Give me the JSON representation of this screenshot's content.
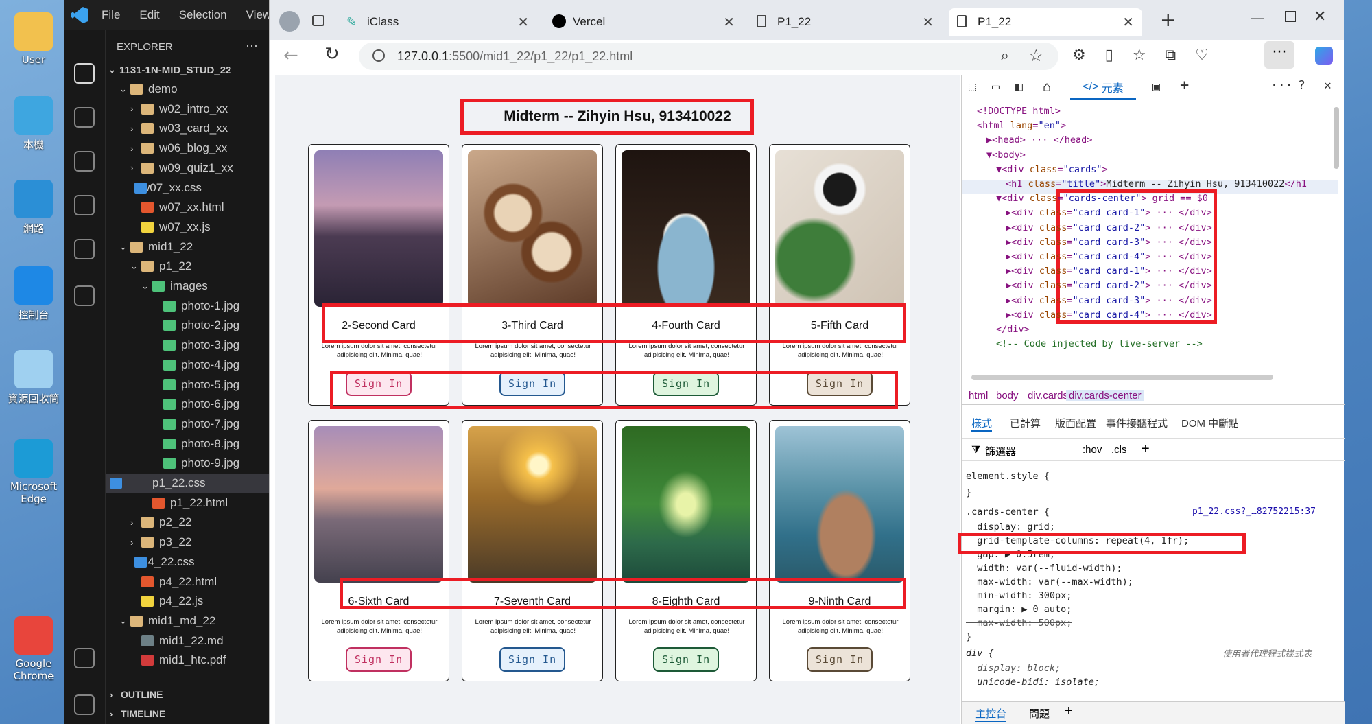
{
  "desktop": {
    "icons": [
      {
        "label": "User",
        "color": "#f2c14e"
      },
      {
        "label": "本機",
        "color": "#3ea6e0"
      },
      {
        "label": "網路",
        "color": "#2b8fd6"
      },
      {
        "label": "控制台",
        "color": "#1e88e5"
      },
      {
        "label": "資源回收筒",
        "color": "#9fd0f0"
      },
      {
        "label": "Microsoft Edge",
        "color": "#1c9bd6"
      },
      {
        "label": "Google Chrome",
        "color": "#e8453c"
      }
    ]
  },
  "vscode": {
    "menu": [
      "File",
      "Edit",
      "Selection",
      "View"
    ],
    "explorer_title": "EXPLORER",
    "explorer_more": "···",
    "root": "1131-1N-MID_STUD_22",
    "tree": [
      {
        "label": "demo",
        "icon": "folder",
        "arrow": "⌄",
        "indent": 1
      },
      {
        "label": "w02_intro_xx",
        "icon": "folder",
        "arrow": "›",
        "indent": 2
      },
      {
        "label": "w03_card_xx",
        "icon": "folder",
        "arrow": "›",
        "indent": 2
      },
      {
        "label": "w06_blog_xx",
        "icon": "folder",
        "arrow": "›",
        "indent": 2
      },
      {
        "label": "w09_quiz1_xx",
        "icon": "folder",
        "arrow": "›",
        "indent": 2
      },
      {
        "label": "w07_xx.css",
        "icon": "css",
        "arrow": "",
        "indent": 2
      },
      {
        "label": "w07_xx.html",
        "icon": "html",
        "arrow": "",
        "indent": 2
      },
      {
        "label": "w07_xx.js",
        "icon": "js",
        "arrow": "",
        "indent": 2
      },
      {
        "label": "mid1_22",
        "icon": "folder",
        "arrow": "⌄",
        "indent": 1
      },
      {
        "label": "p1_22",
        "icon": "folder",
        "arrow": "⌄",
        "indent": 2
      },
      {
        "label": "images",
        "icon": "img",
        "arrow": "⌄",
        "indent": 3
      },
      {
        "label": "photo-1.jpg",
        "icon": "img",
        "arrow": "",
        "indent": 4
      },
      {
        "label": "photo-2.jpg",
        "icon": "img",
        "arrow": "",
        "indent": 4
      },
      {
        "label": "photo-3.jpg",
        "icon": "img",
        "arrow": "",
        "indent": 4
      },
      {
        "label": "photo-4.jpg",
        "icon": "img",
        "arrow": "",
        "indent": 4
      },
      {
        "label": "photo-5.jpg",
        "icon": "img",
        "arrow": "",
        "indent": 4
      },
      {
        "label": "photo-6.jpg",
        "icon": "img",
        "arrow": "",
        "indent": 4
      },
      {
        "label": "photo-7.jpg",
        "icon": "img",
        "arrow": "",
        "indent": 4
      },
      {
        "label": "photo-8.jpg",
        "icon": "img",
        "arrow": "",
        "indent": 4
      },
      {
        "label": "photo-9.jpg",
        "icon": "img",
        "arrow": "",
        "indent": 4
      },
      {
        "label": "p1_22.css",
        "icon": "css",
        "arrow": "",
        "indent": 3,
        "selected": true
      },
      {
        "label": "p1_22.html",
        "icon": "html",
        "arrow": "",
        "indent": 3
      },
      {
        "label": "p2_22",
        "icon": "folder",
        "arrow": "›",
        "indent": 2
      },
      {
        "label": "p3_22",
        "icon": "folder",
        "arrow": "›",
        "indent": 2
      },
      {
        "label": "p4_22.css",
        "icon": "css",
        "arrow": "",
        "indent": 2
      },
      {
        "label": "p4_22.html",
        "icon": "html",
        "arrow": "",
        "indent": 2
      },
      {
        "label": "p4_22.js",
        "icon": "js",
        "arrow": "",
        "indent": 2
      },
      {
        "label": "mid1_md_22",
        "icon": "folder",
        "arrow": "⌄",
        "indent": 1
      },
      {
        "label": "mid1_22.md",
        "icon": "md",
        "arrow": "",
        "indent": 2
      },
      {
        "label": "mid1_htc.pdf",
        "icon": "pdf",
        "arrow": "",
        "indent": 2
      }
    ],
    "outline": "OUTLINE",
    "timeline": "TIMELINE"
  },
  "browser": {
    "tabs": [
      {
        "label": "iClass"
      },
      {
        "label": "Vercel"
      },
      {
        "label": "P1_22"
      },
      {
        "label": "P1_22",
        "active": true
      }
    ],
    "new_tab": "+",
    "url_host": "127.0.0.1",
    "url_rest": ":5500/mid1_22/p1_22/p1_22.html"
  },
  "page": {
    "title": "Midterm -- Zihyin Hsu, 913410022",
    "cards": [
      {
        "title": "2-Second Card",
        "text": "Lorem ipsum dolor sit amet, consectetur adipisicing elit. Minima, quae!",
        "button": "Sign In",
        "style": "b1",
        "photo": "linear-gradient(180deg,#8f7fb5 0%,#c49bb3 35%,#4b3b52 55%,#2a2335 100%)"
      },
      {
        "title": "3-Third Card",
        "text": "Lorem ipsum dolor sit amet, consectetur adipisicing elit. Minima, quae!",
        "button": "Sign In",
        "style": "b2",
        "photo": "radial-gradient(circle at 35% 40%,#e9d3b6 0 14%,#7a4a2a 16% 22%,transparent 24%),radial-gradient(circle at 65% 65%,#ecd8bd 0 14%,#6d3f22 16% 22%,transparent 24%),linear-gradient(160deg,#caa88a,#5d3b28)"
      },
      {
        "title": "4-Fourth Card",
        "text": "Lorem ipsum dolor sit amet, consectetur adipisicing elit. Minima, quae!",
        "button": "Sign In",
        "style": "b3",
        "photo": "radial-gradient(ellipse at 50% 75%,#8ab5cf 0 30%,transparent 32%),radial-gradient(circle at 50% 55%,#f2efe8 0 20%,transparent 22%),linear-gradient(180deg,#1e1410,#3a2a1f)"
      },
      {
        "title": "5-Fifth Card",
        "text": "Lorem ipsum dolor sit amet, consectetur adipisicing elit. Minima, quae!",
        "button": "Sign In",
        "style": "b4",
        "photo": "radial-gradient(circle at 50% 25%,#1a1a1a 0 12%,#f4f4f4 13% 18%,transparent 20%),radial-gradient(circle at 30% 70%,#3e7d3a 0 25%,transparent 30%),linear-gradient(135deg,#e7e0d6,#cfc3b4)"
      },
      {
        "title": "6-Sixth Card",
        "text": "Lorem ipsum dolor sit amet, consectetur adipisicing elit. Minima, quae!",
        "button": "Sign In",
        "style": "b1",
        "photo": "linear-gradient(180deg,#a78db8 0%,#e0a99a 40%,#7a6a78 60%,#44414e 100%)"
      },
      {
        "title": "7-Seventh Card",
        "text": "Lorem ipsum dolor sit amet, consectetur adipisicing elit. Minima, quae!",
        "button": "Sign In",
        "style": "b2",
        "photo": "radial-gradient(circle at 55% 25%,#fff6c8 0 6%,#f5c04a 10%,transparent 30%),linear-gradient(180deg,#d6a24a 0%,#9a6b2a 45%,#4a3a28 100%)"
      },
      {
        "title": "8-Eighth Card",
        "text": "Lorem ipsum dolor sit amet, consectetur adipisicing elit. Minima, quae!",
        "button": "Sign In",
        "style": "b3",
        "photo": "radial-gradient(ellipse at 50% 50%,#e8f3a8 0 10%,transparent 30%),linear-gradient(180deg,#2e6a22 0%,#3f8a3a 50%,#2d6a4a 75%,#1d4a3a 100%)"
      },
      {
        "title": "9-Ninth Card",
        "text": "Lorem ipsum dolor sit amet, consectetur adipisicing elit. Minima, quae!",
        "button": "Sign In",
        "style": "b4",
        "photo": "radial-gradient(ellipse at 55% 70%,#b08060 0 25%,transparent 30%),linear-gradient(180deg,#9ec3d6 0%,#5b93a8 40%,#31708a 70%,#2a5a6a 100%)"
      }
    ]
  },
  "devtools": {
    "tab_elements": "元素",
    "code": [
      {
        "i": 0,
        "html": "&lt;!DOCTYPE html&gt;"
      },
      {
        "i": 0,
        "html": "&lt;html <span class='at'>lang</span>=<span class='av'>\"en\"</span>&gt;"
      },
      {
        "i": 1,
        "html": "▶&lt;head&gt; ··· &lt;/head&gt;"
      },
      {
        "i": 1,
        "html": "▼&lt;body&gt;"
      },
      {
        "i": 2,
        "html": "▼&lt;div <span class='at'>class</span>=<span class='av'>\"cards\"</span>&gt;"
      },
      {
        "i": 3,
        "html": "&lt;h1 <span class='at'>class</span>=<span class='av'>\"title\"</span>&gt;<span class='tx'>Midterm -- Zihyin Hsu, 913410022</span>&lt;/h1"
      },
      {
        "i": 2,
        "html": "▼&lt;div <span class='at'>class</span>=<span class='av'>\"cards-center\"</span>&gt; grid == $0"
      },
      {
        "i": 3,
        "html": "▶&lt;div <span class='at'>class</span>=<span class='av'>\"card card-1\"</span>&gt; ··· &lt;/div&gt;"
      },
      {
        "i": 3,
        "html": "▶&lt;div <span class='at'>class</span>=<span class='av'>\"card card-2\"</span>&gt; ··· &lt;/div&gt;"
      },
      {
        "i": 3,
        "html": "▶&lt;div <span class='at'>class</span>=<span class='av'>\"card card-3\"</span>&gt; ··· &lt;/div&gt;"
      },
      {
        "i": 3,
        "html": "▶&lt;div <span class='at'>class</span>=<span class='av'>\"card card-4\"</span>&gt; ··· &lt;/div&gt;"
      },
      {
        "i": 3,
        "html": "▶&lt;div <span class='at'>class</span>=<span class='av'>\"card card-1\"</span>&gt; ··· &lt;/div&gt;"
      },
      {
        "i": 3,
        "html": "▶&lt;div <span class='at'>class</span>=<span class='av'>\"card card-2\"</span>&gt; ··· &lt;/div&gt;"
      },
      {
        "i": 3,
        "html": "▶&lt;div <span class='at'>class</span>=<span class='av'>\"card card-3\"</span>&gt; ··· &lt;/div&gt;"
      },
      {
        "i": 3,
        "html": "▶&lt;div <span class='at'>class</span>=<span class='av'>\"card card-4\"</span>&gt; ··· &lt;/div&gt;"
      },
      {
        "i": 2,
        "html": "&lt;/div&gt;"
      },
      {
        "i": 2,
        "html": "<span class='cm'>&lt;!-- Code injected by live-server --&gt;</span>"
      }
    ],
    "breadcrumb": [
      "html",
      "body",
      "div.cards",
      "div.cards-center"
    ],
    "style_tabs": [
      "樣式",
      "已計算",
      "版面配置",
      "事件接聽程式",
      "DOM 中斷點"
    ],
    "filter": "篩選器",
    "hov": ":hov",
    "cls": ".cls",
    "css": [
      {
        "t": "element.style {"
      },
      {
        "t": "}"
      },
      {
        "t": ".cards-center {"
      },
      {
        "t": "  display: grid;",
        "p": true
      },
      {
        "t": "  grid-template-columns: repeat(4, 1fr);",
        "p": true
      },
      {
        "t": "  gap: ▶ 0.5rem;",
        "p": true
      },
      {
        "t": "  width: var(--fluid-width);",
        "p": true
      },
      {
        "t": "  max-width: var(--max-width);",
        "p": true
      },
      {
        "t": "  min-width: 300px;",
        "p": true
      },
      {
        "t": "  margin: ▶ 0 auto;",
        "p": true
      },
      {
        "t": "  max-width: 500px;",
        "p": true
      },
      {
        "t": "}"
      },
      {
        "t": "div {"
      },
      {
        "t": "  display: block;",
        "p": true
      },
      {
        "t": "  unicode-bidi: isolate;",
        "p": true
      }
    ],
    "source_link": "p1_22.css?_…82752215:37",
    "ua_label": "使用者代理程式樣式表",
    "console_tab": "主控台",
    "issues_tab": "問題"
  }
}
